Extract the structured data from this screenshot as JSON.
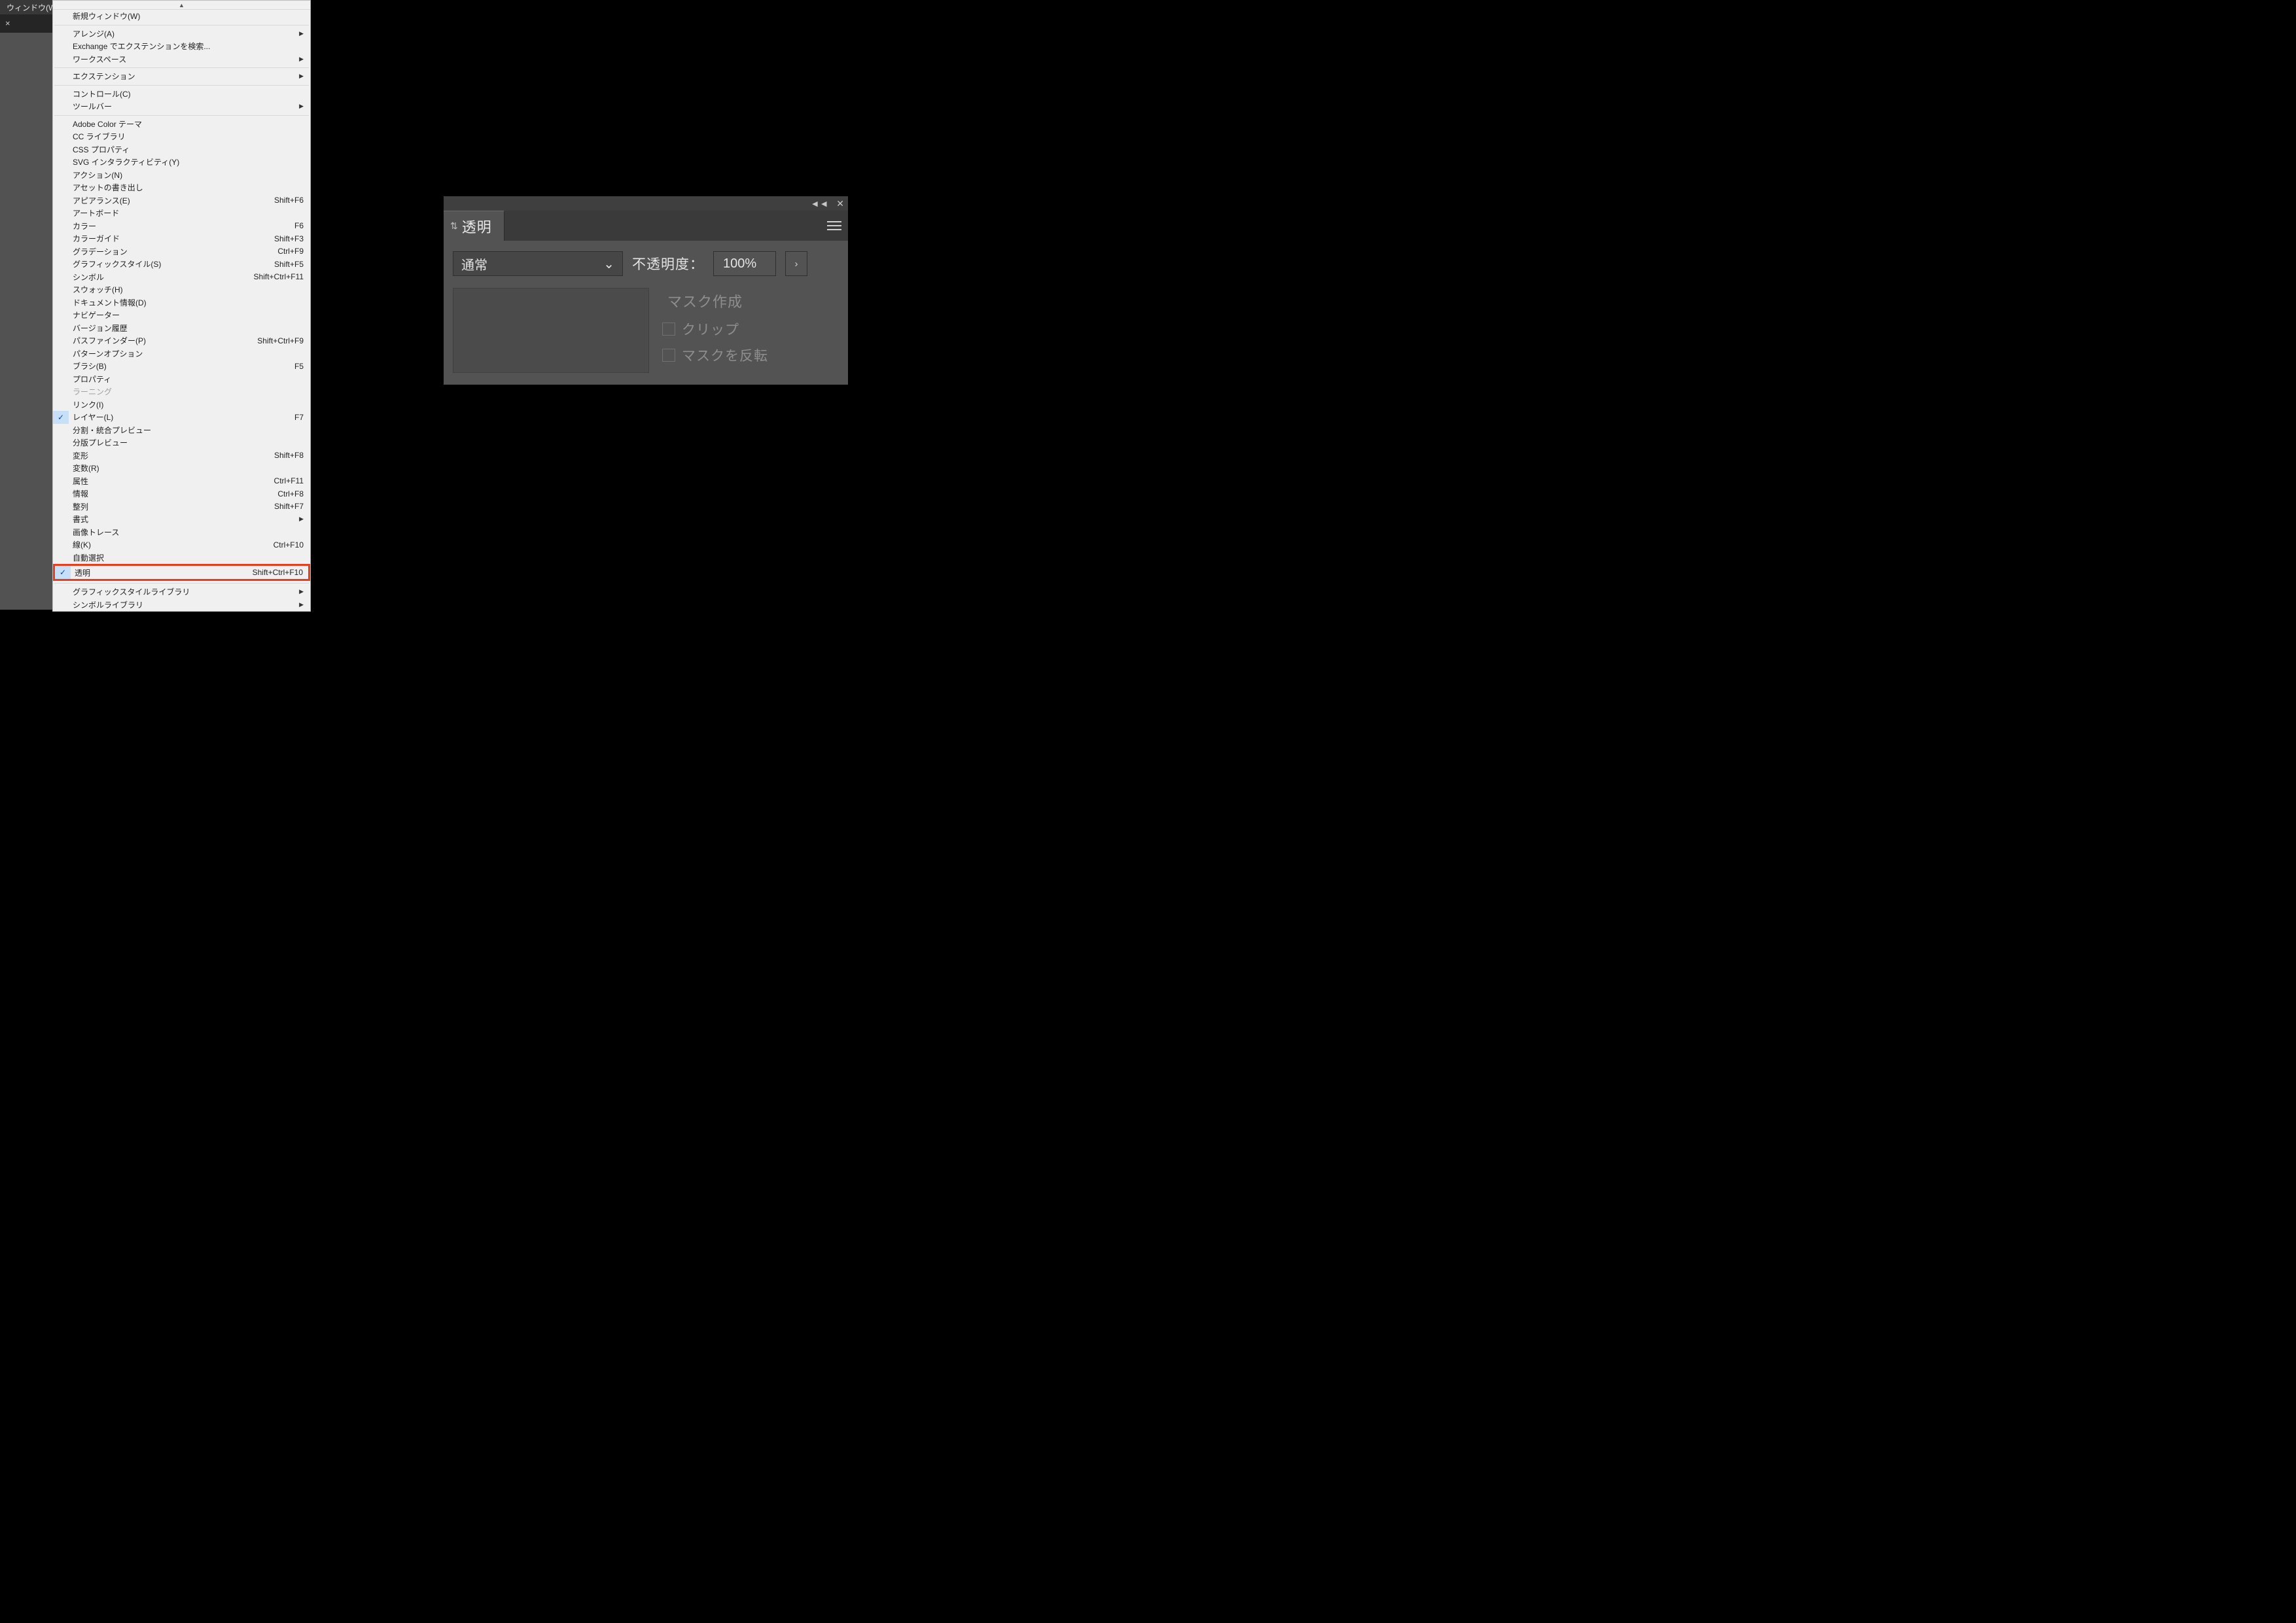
{
  "menubar": {
    "window_label": "ウィンドウ(W)"
  },
  "doc_close": "×",
  "menu": {
    "new_window": "新規ウィンドウ(W)",
    "arrange": "アレンジ(A)",
    "exchange": "Exchange でエクステンションを検索...",
    "workspace": "ワークスペース",
    "extension": "エクステンション",
    "control": "コントロール(C)",
    "toolbar": "ツールバー",
    "adobe_color": "Adobe Color テーマ",
    "cc_lib": "CC ライブラリ",
    "css_prop": "CSS プロパティ",
    "svg_inter": "SVG インタラクティビティ(Y)",
    "action": "アクション(N)",
    "asset_export": "アセットの書き出し",
    "appearance": "アピアランス(E)",
    "appearance_sc": "Shift+F6",
    "artboard": "アートボード",
    "color": "カラー",
    "color_sc": "F6",
    "color_guide": "カラーガイド",
    "color_guide_sc": "Shift+F3",
    "gradient": "グラデーション",
    "gradient_sc": "Ctrl+F9",
    "graphic_style": "グラフィックスタイル(S)",
    "graphic_style_sc": "Shift+F5",
    "symbol": "シンボル",
    "symbol_sc": "Shift+Ctrl+F11",
    "swatch": "スウォッチ(H)",
    "doc_info": "ドキュメント情報(D)",
    "navigator": "ナビゲーター",
    "version_hist": "バージョン履歴",
    "pathfinder": "パスファインダー(P)",
    "pathfinder_sc": "Shift+Ctrl+F9",
    "pattern_opt": "パターンオプション",
    "brush": "ブラシ(B)",
    "brush_sc": "F5",
    "property": "プロパティ",
    "learning": "ラーニング",
    "link": "リンク(I)",
    "layer": "レイヤー(L)",
    "layer_sc": "F7",
    "flatten_prev": "分割・統合プレビュー",
    "sep_prev": "分版プレビュー",
    "transform": "変形",
    "transform_sc": "Shift+F8",
    "variables": "変数(R)",
    "attributes": "属性",
    "attributes_sc": "Ctrl+F11",
    "info": "情報",
    "info_sc": "Ctrl+F8",
    "align": "整列",
    "align_sc": "Shift+F7",
    "type": "書式",
    "image_trace": "画像トレース",
    "stroke": "線(K)",
    "stroke_sc": "Ctrl+F10",
    "magic_wand": "自動選択",
    "transparency": "透明",
    "transparency_sc": "Shift+Ctrl+F10",
    "gfx_style_lib": "グラフィックスタイルライブラリ",
    "symbol_lib": "シンボルライブラリ"
  },
  "panel": {
    "title": "透明",
    "blend_mode": "通常",
    "opacity_label": "不透明度：",
    "opacity_value": "100%",
    "make_mask": "マスク作成",
    "clip": "クリップ",
    "invert_mask": "マスクを反転"
  }
}
